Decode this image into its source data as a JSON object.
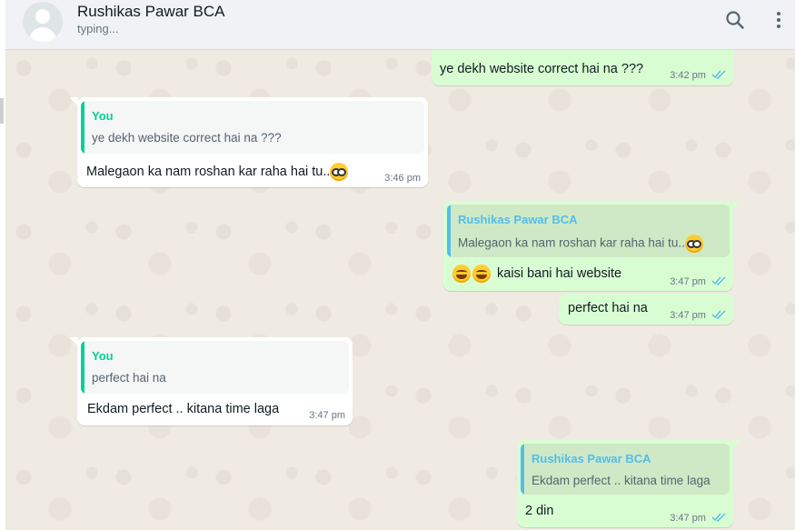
{
  "header": {
    "contact_name": "Rushikas Pawar BCA",
    "status": "typing...",
    "search_icon": "search-icon",
    "menu_icon": "more-vertical-icon"
  },
  "colors": {
    "incoming_bubble": "#ffffff",
    "outgoing_bubble": "#d9fdd3",
    "chat_background": "#efeae2",
    "quote_you": "#06cf9c",
    "quote_contact": "#53bdeb",
    "read_ticks": "#53bdeb"
  },
  "messages": [
    {
      "direction": "out",
      "text": "ye dekh website correct hai na ???",
      "time": "3:42 pm",
      "status_icon": "double-check-read-icon"
    },
    {
      "direction": "in",
      "quote": {
        "author": "You",
        "text": "ye dekh website correct hai na ???"
      },
      "text": "Malegaon ka nam roshan kar raha hai tu..",
      "emoji": "nerd-face-emoji",
      "time": "3:46 pm"
    },
    {
      "direction": "out",
      "quote": {
        "author": "Rushikas Pawar BCA",
        "text": "Malegaon ka nam roshan kar raha hai tu..",
        "emoji": "nerd-face-emoji"
      },
      "emoji_prefix": "laughing-emoji x2",
      "text": "kaisi bani hai website",
      "time": "3:47 pm",
      "status_icon": "double-check-read-icon"
    },
    {
      "direction": "out",
      "text": "perfect hai na",
      "time": "3:47 pm",
      "status_icon": "double-check-read-icon"
    },
    {
      "direction": "in",
      "quote": {
        "author": "You",
        "text": "perfect hai na"
      },
      "text": "Ekdam perfect .. kitana time laga",
      "time": "3:47 pm"
    },
    {
      "direction": "out",
      "quote": {
        "author": "Rushikas Pawar BCA",
        "text": "Ekdam perfect .. kitana time laga"
      },
      "text": "2 din",
      "time": "3:47 pm",
      "status_icon": "double-check-read-icon"
    }
  ]
}
